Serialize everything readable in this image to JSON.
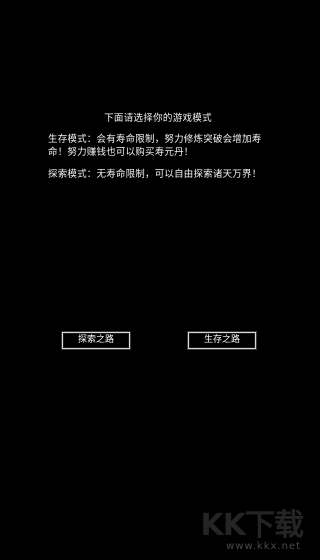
{
  "intro": {
    "title": "下面请选择你的游戏模式",
    "survival_desc": "生存模式：会有寿命限制，努力修炼突破会增加寿命！努力赚钱也可以购买寿元丹！",
    "explore_desc": "探索模式：无寿命限制，可以自由探索诸天万界！"
  },
  "buttons": {
    "explore": "探索之路",
    "survival": "生存之路"
  },
  "watermark": {
    "logo_text": "KK下载",
    "url": "www.kkx.net"
  },
  "colors": {
    "background": "#000000",
    "text": "#f2f2f2",
    "button_border": "#d8d8d8"
  }
}
